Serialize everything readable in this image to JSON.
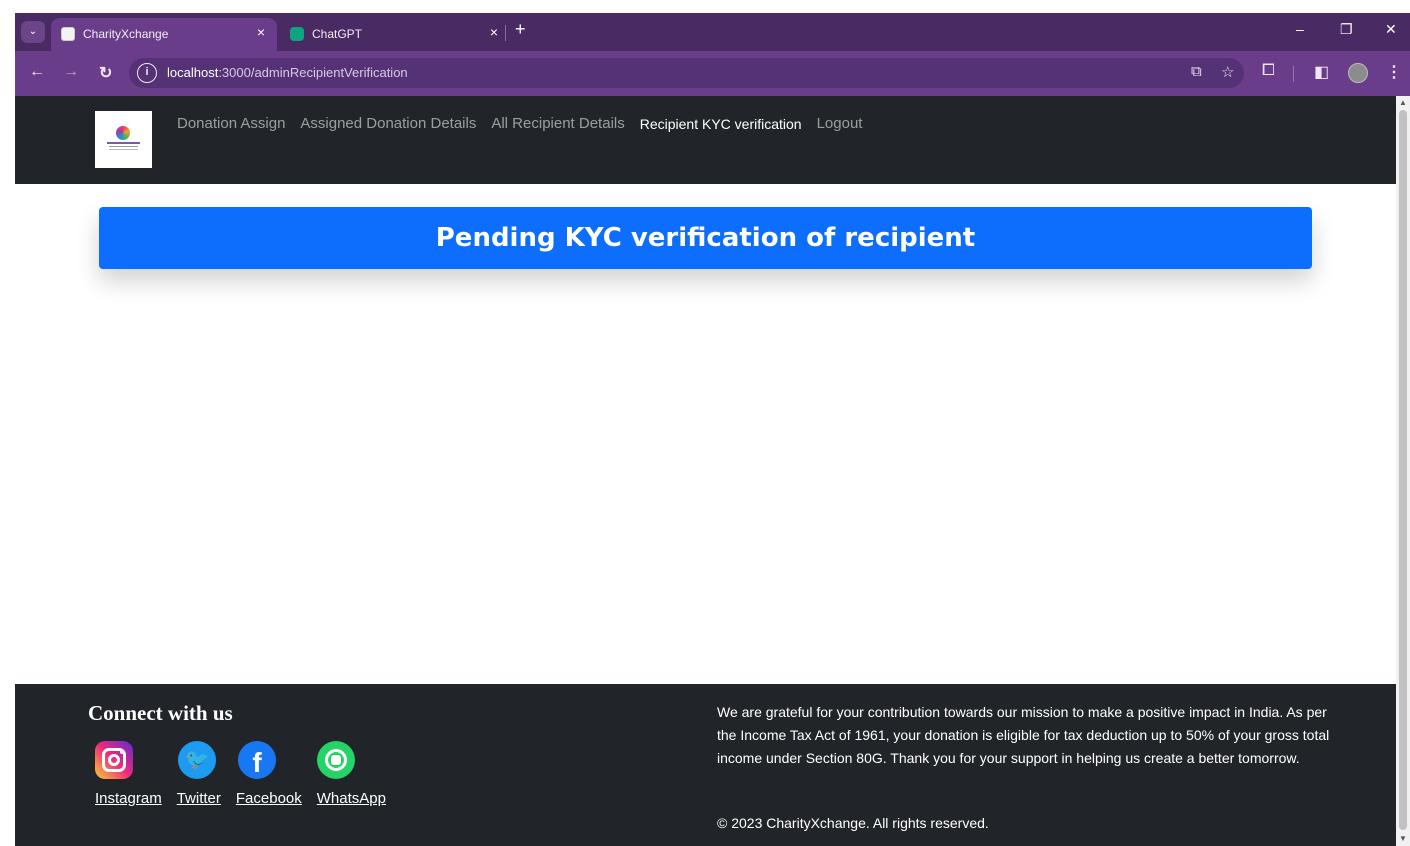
{
  "browser": {
    "tabs": [
      {
        "title": "CharityXchange",
        "active": true
      },
      {
        "title": "ChatGPT",
        "active": false
      }
    ],
    "new_tab_symbol": "+",
    "tab_close_symbol": "×",
    "url_host": "localhost",
    "url_rest": ":3000/adminRecipientVerification",
    "window_controls": {
      "minimize": "–",
      "maximize": "❐",
      "close": "✕"
    }
  },
  "site": {
    "nav_links": [
      {
        "label": "Donation Assign",
        "active": false
      },
      {
        "label": "Assigned Donation Details",
        "active": false
      },
      {
        "label": "All Recipient Details",
        "active": false
      },
      {
        "label": "Recipient KYC verification",
        "active": true
      },
      {
        "label": "Logout",
        "active": false
      }
    ],
    "banner_title": "Pending KYC verification of recipient"
  },
  "footer": {
    "connect_heading": "Connect with us",
    "social_labels": [
      "Instagram",
      "Twitter",
      "Facebook",
      "WhatsApp"
    ],
    "note": "We are grateful for your contribution towards our mission to make a positive impact in India. As per the Income Tax Act of 1961, your donation is eligible for tax deduction up to 50% of your gross total income under Section 80G. Thank you for your support in helping us create a better tomorrow.",
    "copyright": "© 2023 CharityXchange. All rights reserved."
  },
  "colors": {
    "browser_frame": "#4a2a63",
    "toolbar": "#6a3d8a",
    "site_dark": "#212529",
    "banner_blue": "#0d6efd"
  },
  "icons": [
    "back-icon",
    "forward-icon",
    "reload-icon",
    "site-info-icon",
    "cast-icon",
    "bookmark-star-icon",
    "extensions-icon",
    "side-panel-icon",
    "profile-avatar",
    "menu-kebab-icon",
    "instagram-icon",
    "twitter-icon",
    "facebook-icon",
    "whatsapp-icon"
  ]
}
